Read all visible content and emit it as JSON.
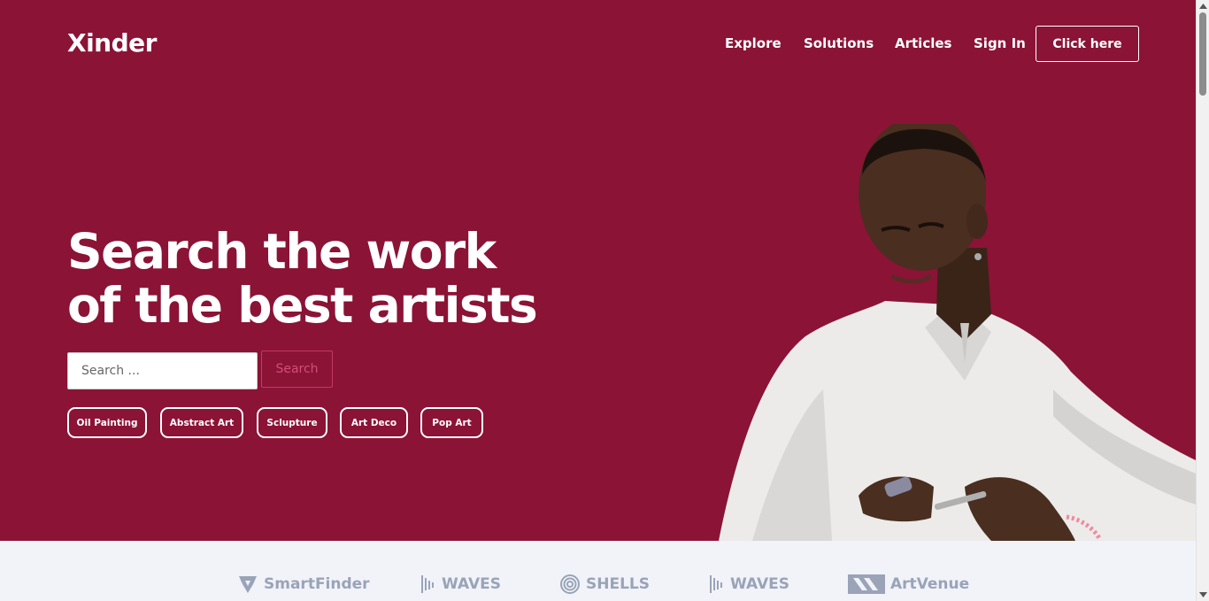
{
  "brand": {
    "name": "Xinder"
  },
  "nav": {
    "items": [
      {
        "label": "Explore"
      },
      {
        "label": "Solutions"
      },
      {
        "label": "Articles"
      },
      {
        "label": "Sign In"
      }
    ],
    "cta_label": "Click here"
  },
  "hero": {
    "headline": "Search the work of the best artists",
    "search": {
      "placeholder": "Search ...",
      "button_label": "Search"
    },
    "tags": [
      "Oil Painting",
      "Abstract Art",
      "Sclupture",
      "Art Deco",
      "Pop Art"
    ]
  },
  "logos": [
    {
      "name": "SmartFinder",
      "icon": "smartfinder-icon"
    },
    {
      "name": "WAVES",
      "icon": "waves-icon"
    },
    {
      "name": "SHELLS",
      "icon": "shells-icon"
    },
    {
      "name": "WAVES",
      "icon": "waves-icon"
    },
    {
      "name": "ArtVenue",
      "icon": "artvenue-icon"
    }
  ],
  "colors": {
    "hero_bg": "#8b1336",
    "logo_strip_bg": "#f1f3f8",
    "logo_color": "#9aa3b8",
    "search_accent": "#c23a62"
  }
}
